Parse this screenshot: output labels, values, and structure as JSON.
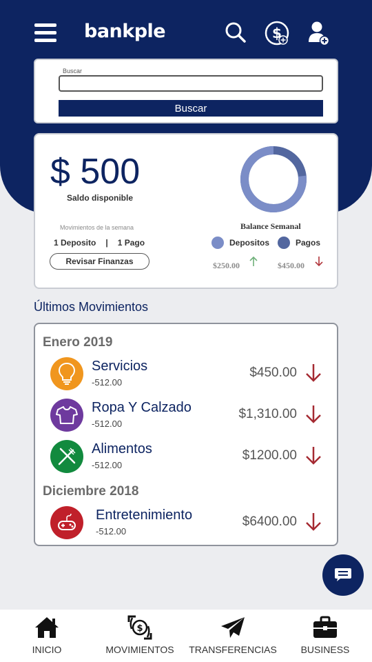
{
  "app": {
    "logo": "bankple"
  },
  "colors": {
    "primary": "#0d2461",
    "donut_light": "#7b8dc7",
    "donut_dark": "#53679f"
  },
  "search": {
    "label": "Buscar",
    "value": "",
    "placeholder": "",
    "button": "Buscar"
  },
  "balance": {
    "amount": "$ 500",
    "amount_label": "Saldo disponible",
    "week_label": "Movimientos de la semana",
    "deposits_count": "1 Deposito",
    "separator": "|",
    "payments_count": "1 Pago",
    "review_button": "Revisar Finanzas",
    "chart_title": "Balance Semanal",
    "legend_deposits": "Depositos",
    "legend_payments": "Pagos",
    "deposits_amount": "$250.00",
    "payments_amount": "$450.00",
    "donut": {
      "deposits": 250,
      "payments": 450
    }
  },
  "movements": {
    "title": "Últimos Movimientos",
    "groups": [
      {
        "month": "Enero 2019",
        "items": [
          {
            "name": "Servicios",
            "sub": "-512.00",
            "amount": "$450.00",
            "icon": "lightbulb-icon",
            "color": "#f0961e"
          },
          {
            "name": "Ropa Y Calzado",
            "sub": "-512.00",
            "amount": "$1,310.00",
            "icon": "shirt-icon",
            "color": "#6e3a9e"
          },
          {
            "name": "Alimentos",
            "sub": "-512.00",
            "amount": "$1200.00",
            "icon": "utensils-icon",
            "color": "#128a3e"
          }
        ]
      },
      {
        "month": "Diciembre 2018",
        "items": [
          {
            "name": "Entretenimiento",
            "sub": "-512.00",
            "amount": "$6400.00",
            "icon": "gamepad-icon",
            "color": "#c0202a"
          }
        ]
      }
    ]
  },
  "nav": {
    "items": [
      {
        "label": "INICIO",
        "icon": "home-icon"
      },
      {
        "label": "MOVIMIENTOS",
        "icon": "money-transfer-icon"
      },
      {
        "label": "TRANSFERENCIAS",
        "icon": "paper-plane-icon"
      },
      {
        "label": "BUSINESS",
        "icon": "briefcase-icon"
      }
    ]
  }
}
